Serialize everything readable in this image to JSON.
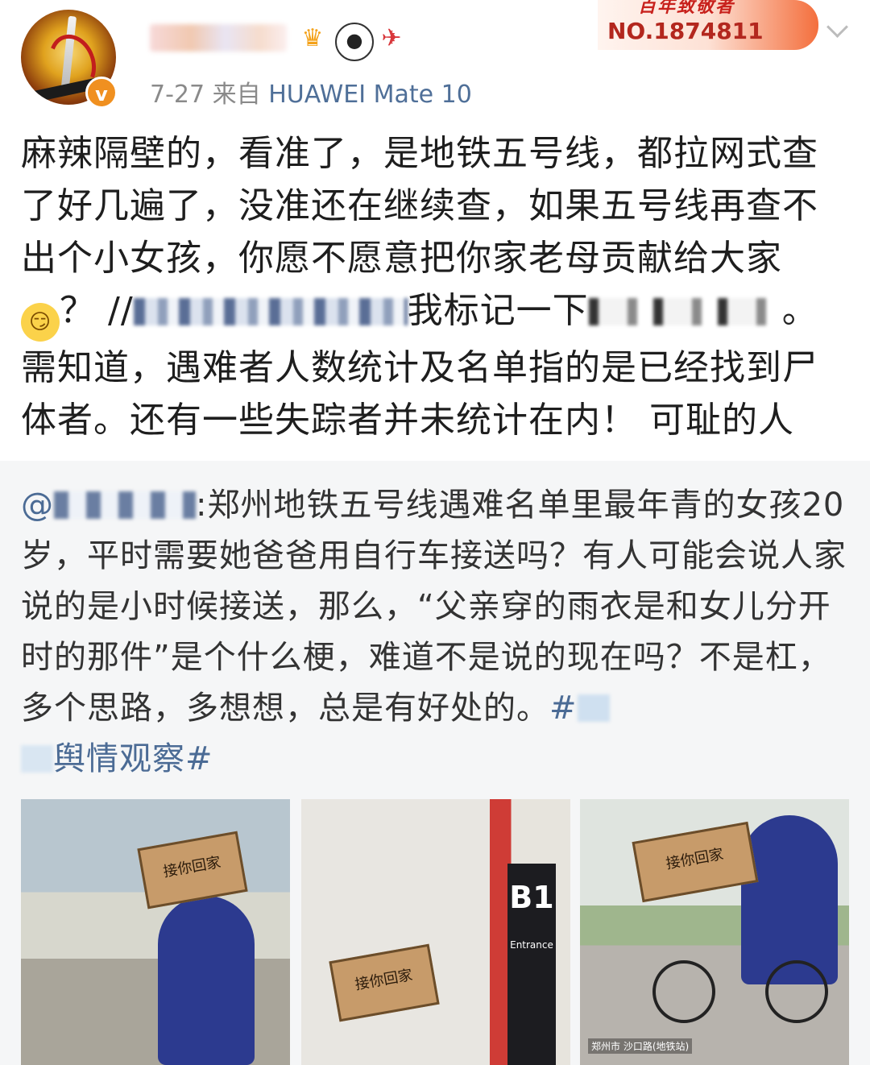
{
  "header": {
    "verified_mark": "v",
    "time": "7-27",
    "source_prefix": "来自",
    "source_device": "HUAWEI Mate 10",
    "promo": {
      "title": "百年致敬者",
      "number": "NO.1874811"
    },
    "badges": [
      "crown-icon",
      "panda-icon",
      "rocket-icon"
    ]
  },
  "post": {
    "line1": "麻辣隔壁的，看准了，是地铁五号线，都拉网式查了好几遍了，没准还在继续查，如果五号线再查不出个小女孩，你愿不愿意把你家老母贡献给大家",
    "q_mark": "？",
    "slashes": "//",
    "mark_text": "我标记一下",
    "period": "。",
    "line2": "需知道，遇难者人数统计及名单指的是已经找到尸体者。还有一些失踪者并未统计在内！ 可耻的人"
  },
  "repost": {
    "at": "@",
    "colon": ":",
    "body": "郑州地铁五号线遇难名单里最年青的女孩20岁，平时需要她爸爸用自行车接送吗？有人可能会说人家说的是小时候接送，那么，“父亲穿的雨衣是和女儿分开时的那件”是个什么梗，难道不是说的现在吗？不是杠，多个思路，多想想，总是有好处的。",
    "hashtag_start": "#",
    "hashtag_tail": "舆情观察#"
  },
  "images": {
    "sign_text": "接你回家",
    "station_label": "B1",
    "station_sub": "Entrance",
    "thumb3_caption": "郑州市 沙口路(地铁站)"
  },
  "colors": {
    "link": "#4f6f98",
    "promo": "#c8221d",
    "verified": "#f09020"
  }
}
